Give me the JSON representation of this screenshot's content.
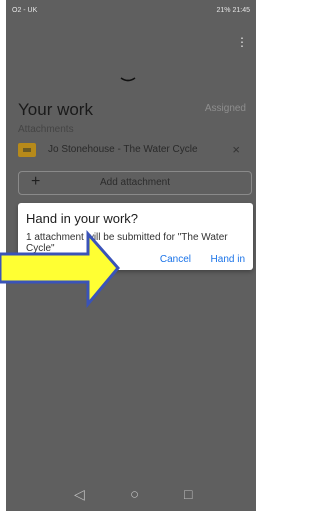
{
  "status_bar": {
    "left": "O2 - UK",
    "right": "21% 21:45"
  },
  "menu": {
    "overflow_icon": "⋮"
  },
  "sheet": {
    "title": "Your work",
    "status": "Assigned",
    "attachments_label": "Attachments",
    "attachment_title": "Jo Stonehouse - The Water Cycle",
    "remove_icon": "×",
    "add_attachment_label": "Add attachment",
    "add_icon": "+"
  },
  "dialog": {
    "title": "Hand in your work?",
    "message": "1 attachment will be submitted for \"The Water Cycle\"",
    "cancel_label": "Cancel",
    "confirm_label": "Hand in"
  },
  "nav": {
    "back": "◁",
    "home": "○",
    "recent": "□"
  },
  "colors": {
    "accent": "#1a73e8",
    "arrow_fill": "#ffff33",
    "arrow_stroke": "#3a53b8"
  }
}
